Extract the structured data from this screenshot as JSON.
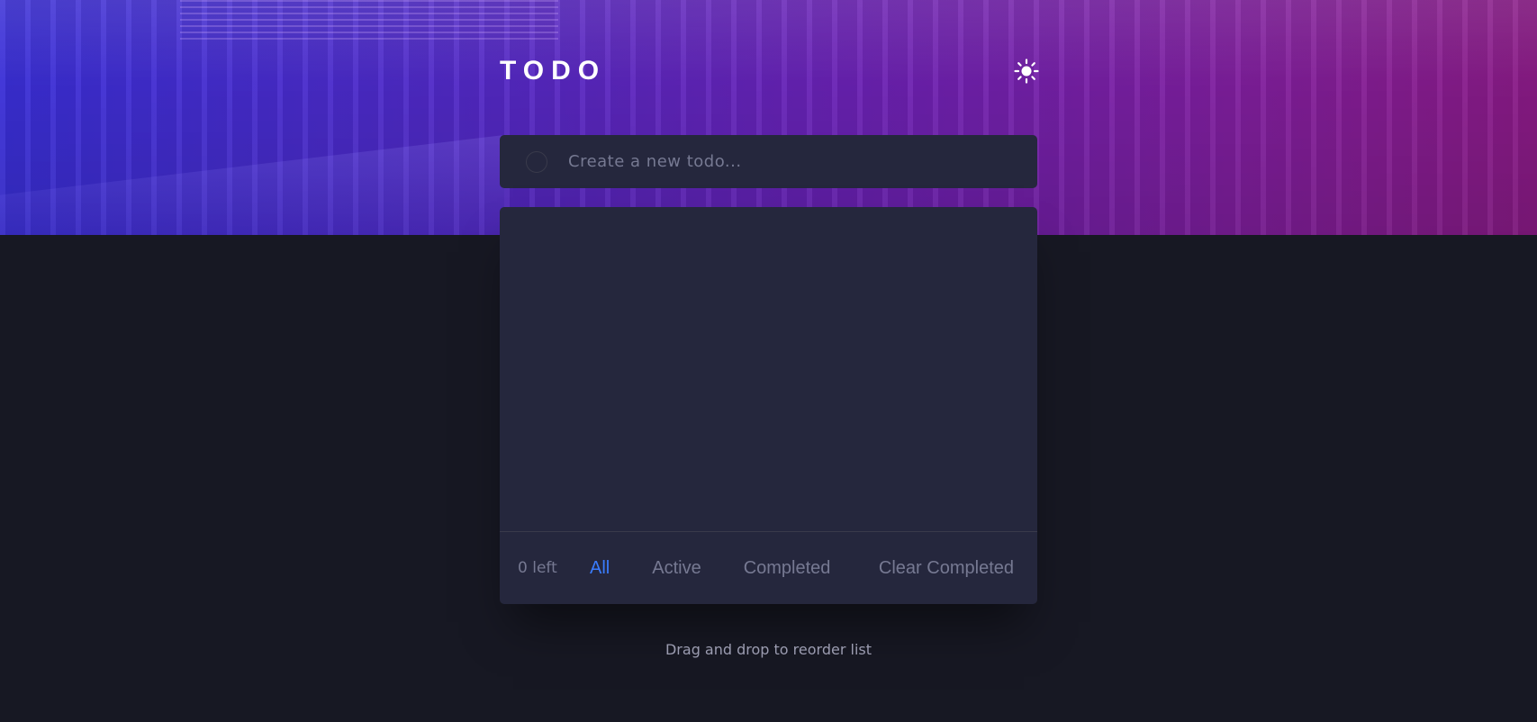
{
  "app": {
    "title": "TODO"
  },
  "theme_toggle": {
    "icon": "sun-icon"
  },
  "new_todo": {
    "placeholder": "Create a new todo...",
    "value": ""
  },
  "todos": [],
  "footer": {
    "items_left": "0 left",
    "filters": [
      {
        "label": "All",
        "active": true
      },
      {
        "label": "Active",
        "active": false
      },
      {
        "label": "Completed",
        "active": false
      }
    ],
    "clear_label": "Clear Completed"
  },
  "hint": "Drag and drop to reorder list",
  "colors": {
    "page_bg": "#171823",
    "card_bg": "#25273d",
    "accent": "#3a7cfd",
    "muted_text": "#767992",
    "divider": "#393a4b"
  }
}
